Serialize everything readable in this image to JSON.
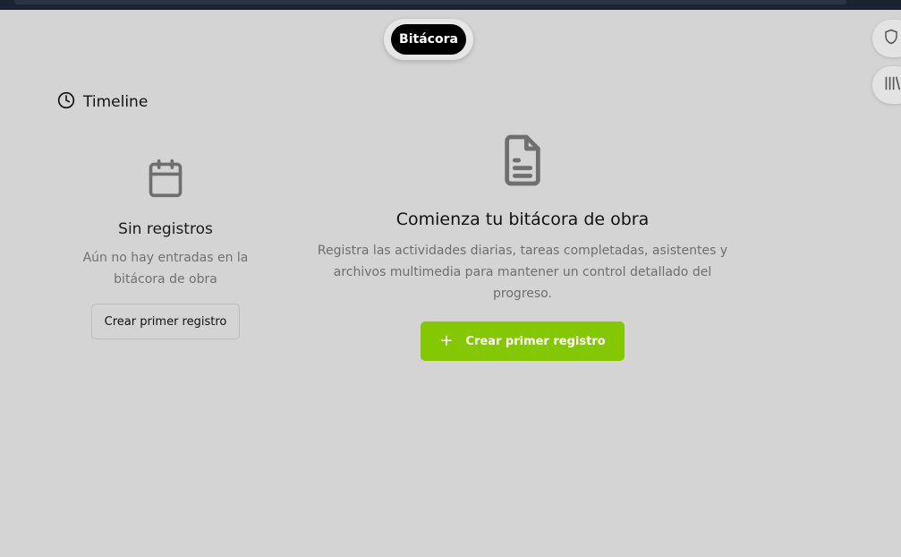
{
  "top_tab": {
    "label": "Bitácora"
  },
  "side_buttons": [
    {
      "icon": "shield-icon"
    },
    {
      "icon": "library-icon"
    }
  ],
  "timeline": {
    "title": "Timeline",
    "icon": "clock-icon"
  },
  "empty_timeline": {
    "icon": "calendar-icon",
    "title": "Sin registros",
    "description": "Aún no hay entradas en la bitácora de obra",
    "button_label": "Crear primer registro"
  },
  "main_empty": {
    "icon": "document-icon",
    "title": "Comienza tu bitácora de obra",
    "description": "Registra las actividades diarias, tareas completadas, asistentes y archivos multimedia para mantener un control detallado del progreso.",
    "button_icon": "plus-icon",
    "button_label": "Crear primer registro"
  },
  "colors": {
    "background": "#d4d4d4",
    "accent_green": "#84c802",
    "tab_active": "#000000"
  }
}
